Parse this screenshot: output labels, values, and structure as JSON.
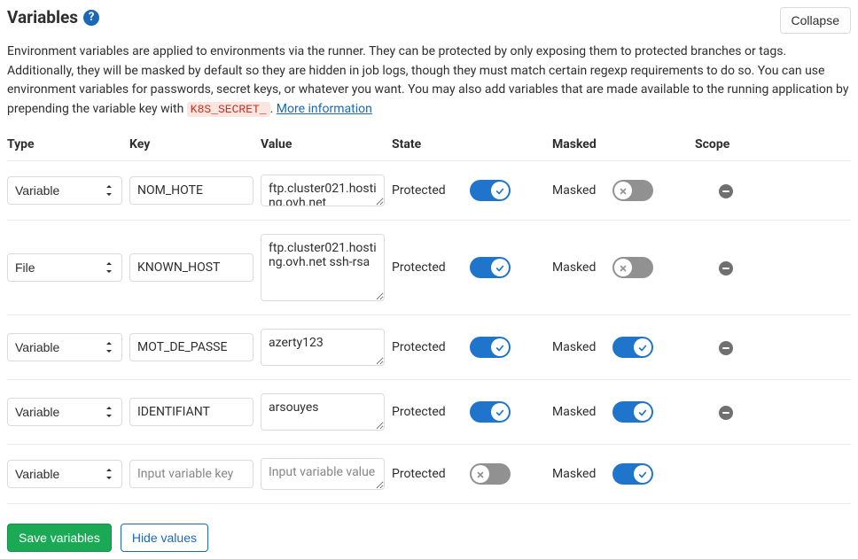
{
  "header": {
    "title": "Variables",
    "collapse": "Collapse"
  },
  "description": {
    "text": "Environment variables are applied to environments via the runner. They can be protected by only exposing them to protected branches or tags. Additionally, they will be masked by default so they are hidden in job logs, though they must match certain regexp requirements to do so. You can use environment variables for passwords, secret keys, or whatever you want. You may also add variables that are made available to the running application by prepending the variable key with ",
    "code": "K8S_SECRET_",
    "more": "More information",
    "period": ". "
  },
  "columns": {
    "type": "Type",
    "key": "Key",
    "value": "Value",
    "state": "State",
    "masked": "Masked",
    "scope": "Scope"
  },
  "labels": {
    "protected": "Protected",
    "masked": "Masked"
  },
  "typeOptions": {
    "variable": "Variable",
    "file": "File"
  },
  "rows": [
    {
      "type": "Variable",
      "key": "NOM_HOTE",
      "value": "ftp.cluster021.hosting.ovh.net",
      "valueHeight": "36px",
      "protected": true,
      "masked": false,
      "removable": true
    },
    {
      "type": "File",
      "key": "KNOWN_HOST",
      "value": "ftp.cluster021.hosting.ovh.net ssh-rsa",
      "valueHeight": "76px",
      "protected": true,
      "masked": false,
      "removable": true
    },
    {
      "type": "Variable",
      "key": "MOT_DE_PASSE",
      "value": "azerty123",
      "valueHeight": "42px",
      "protected": true,
      "masked": true,
      "removable": true
    },
    {
      "type": "Variable",
      "key": "IDENTIFIANT",
      "value": "arsouyes",
      "valueHeight": "42px",
      "protected": true,
      "masked": true,
      "removable": true
    },
    {
      "type": "Variable",
      "key": "",
      "value": "",
      "valueHeight": "36px",
      "keyPlaceholder": "Input variable key",
      "valuePlaceholder": "Input variable value",
      "protected": false,
      "masked": true,
      "removable": false
    }
  ],
  "actions": {
    "save": "Save variables",
    "hide": "Hide values"
  }
}
